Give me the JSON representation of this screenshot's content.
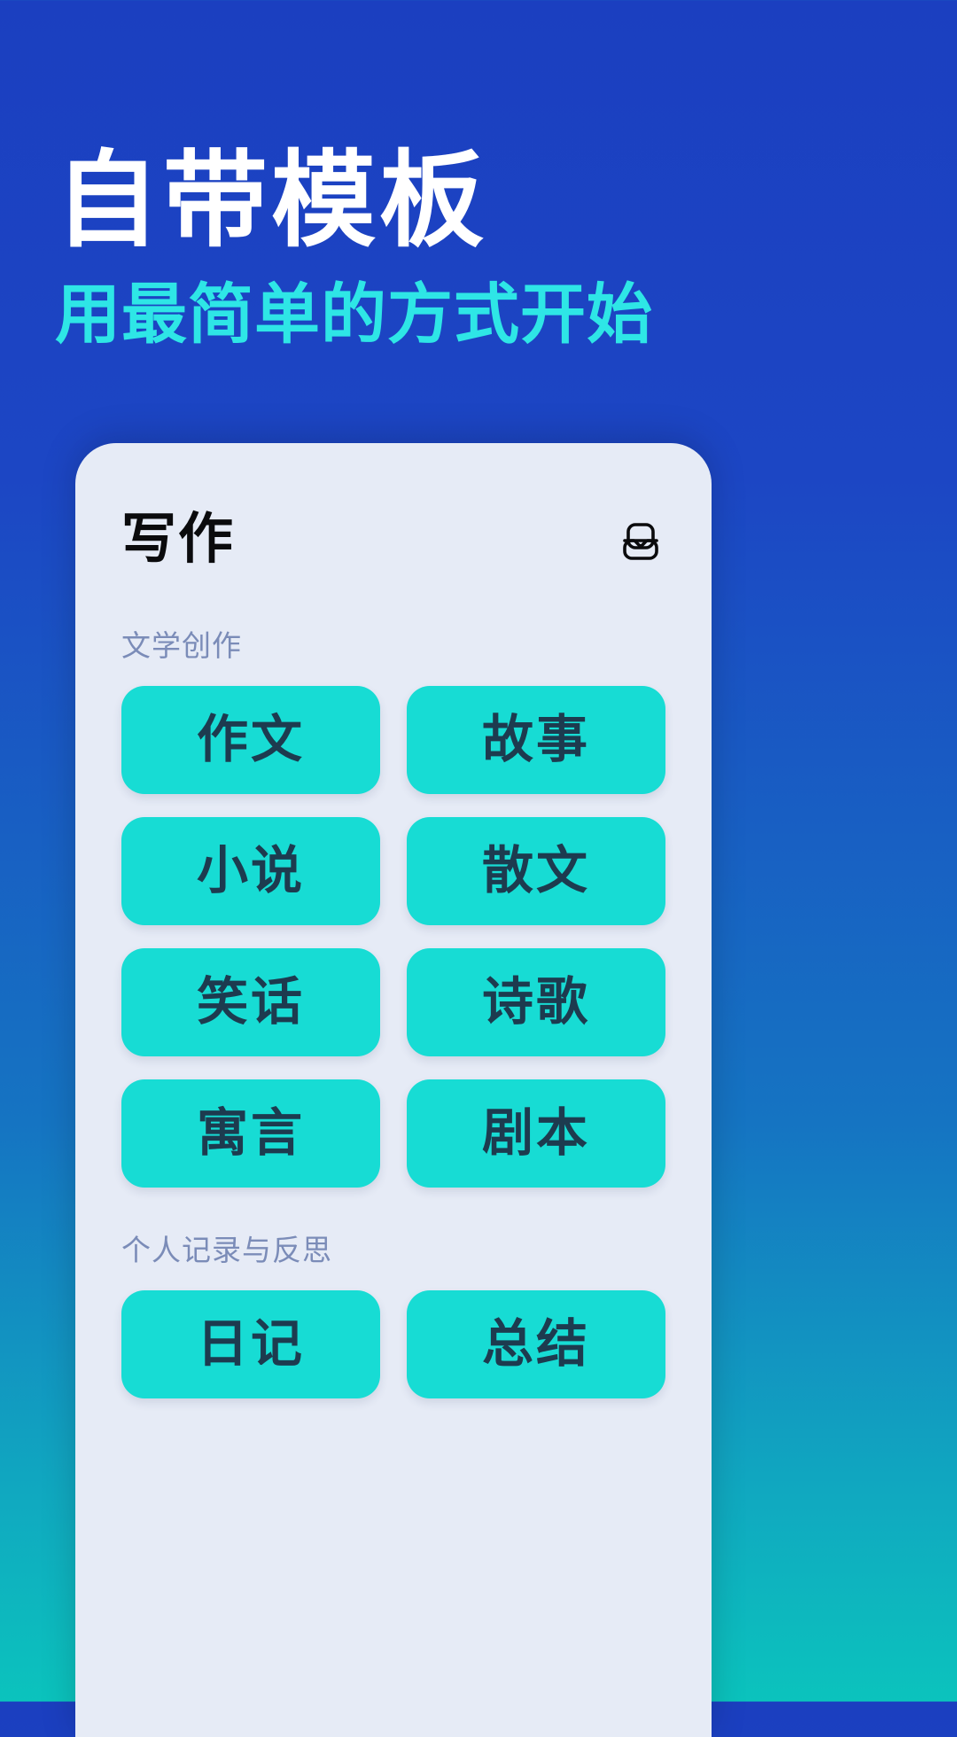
{
  "hero": {
    "title": "自带模板",
    "subtitle": "用最简单的方式开始"
  },
  "colors": {
    "background_top": "#1b3fc0",
    "background_bottom": "#0bc3bd",
    "hero_title": "#ffffff",
    "hero_subtitle": "#2ee6e6",
    "card_background": "#e6ebf6",
    "tile": "#17dcd4",
    "tile_text": "#1d3b4f",
    "section_label": "#7b8cb8"
  },
  "card": {
    "title": "写作",
    "header_icon": "inbox-icon",
    "sections": [
      {
        "label": "文学创作",
        "tiles": [
          "作文",
          "故事",
          "小说",
          "散文",
          "笑话",
          "诗歌",
          "寓言",
          "剧本"
        ]
      },
      {
        "label": "个人记录与反思",
        "tiles": [
          "日记",
          "总结"
        ]
      }
    ]
  }
}
